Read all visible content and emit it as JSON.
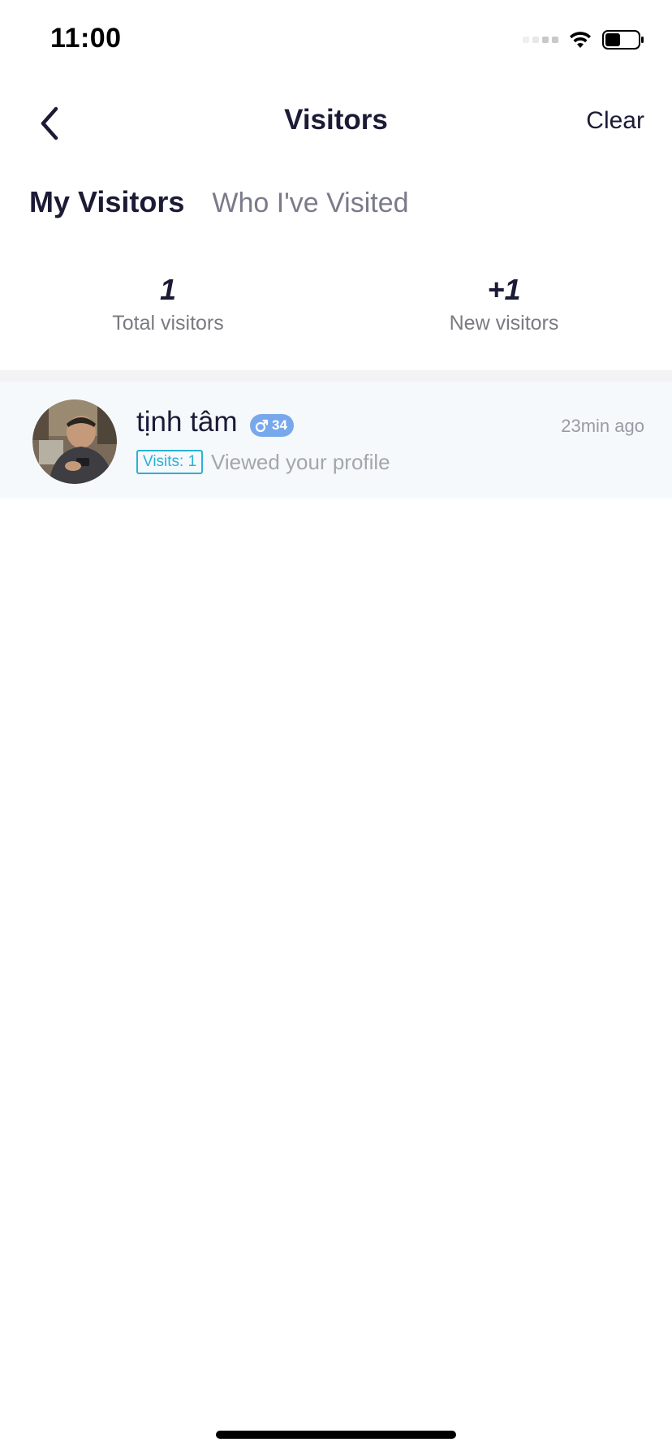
{
  "status_bar": {
    "time": "11:00",
    "icons": [
      "signal-icon",
      "wifi-icon",
      "battery-icon"
    ]
  },
  "nav": {
    "title": "Visitors",
    "back_icon": "chevron-left-icon",
    "clear_label": "Clear"
  },
  "tabs": [
    {
      "label": "My Visitors",
      "active": true
    },
    {
      "label": "Who I've Visited",
      "active": false
    }
  ],
  "stats": {
    "total": {
      "value": "1",
      "label": "Total visitors"
    },
    "new": {
      "value": "+1",
      "label": "New visitors"
    }
  },
  "visitors": [
    {
      "name": "tịnh tâm",
      "gender_icon": "male-icon",
      "age": "34",
      "time": "23min ago",
      "visits_label": "Visits: 1",
      "description": "Viewed your profile"
    }
  ],
  "colors": {
    "primary_text": "#1c1b36",
    "secondary_text": "#7a7a8a",
    "badge_blue": "#78a8ec",
    "visits_teal": "#2bb1d4",
    "row_background": "#f5f9fc"
  }
}
